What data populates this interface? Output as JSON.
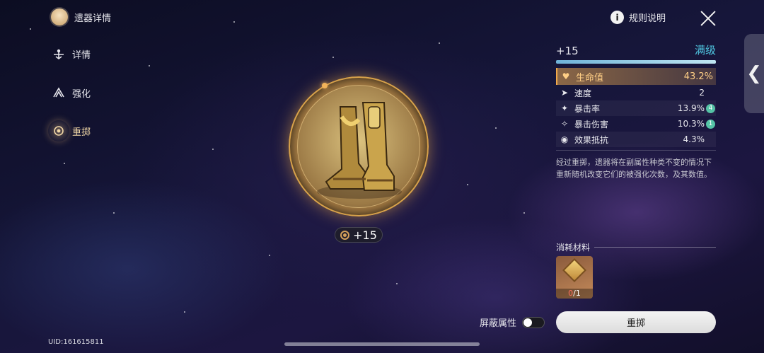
{
  "nav": {
    "header_label": "遗器详情",
    "items": [
      {
        "label": "详情",
        "icon": "detail-icon"
      },
      {
        "label": "强化",
        "icon": "enhance-icon"
      },
      {
        "label": "重掷",
        "icon": "reroll-icon",
        "active": true
      }
    ]
  },
  "topbar": {
    "rules_label": "规则说明",
    "info_icon": "i"
  },
  "relic": {
    "level_badge": "+15",
    "level_badge_icon": "relic-level-icon"
  },
  "panel": {
    "level": "+15",
    "level_status": "满级",
    "level_progress": 1.0,
    "main_stat": {
      "name": "生命值",
      "value": "43.2%",
      "icon": "heart-icon"
    },
    "sub_stats": [
      {
        "name": "速度",
        "value": "2",
        "icon": "speed-icon",
        "boost": ""
      },
      {
        "name": "暴击率",
        "value": "13.9%",
        "icon": "crit-rate-icon",
        "boost": "4"
      },
      {
        "name": "暴击伤害",
        "value": "10.3%",
        "icon": "crit-dmg-icon",
        "boost": "1"
      },
      {
        "name": "效果抵抗",
        "value": "4.3%",
        "icon": "effect-res-icon",
        "boost": ""
      }
    ],
    "description": "经过重掷，遗器将在副属性种类不变的情况下重新随机改变它们的被强化次数，及其数值。"
  },
  "materials": {
    "title": "消耗材料",
    "item_count_have": "0",
    "item_count_need": "/1"
  },
  "footer": {
    "hide_attr_label": "屏蔽属性",
    "reroll_button": "重掷",
    "uid": "UID:161615811"
  },
  "colors": {
    "accent_gold": "#ffcf86",
    "level_max": "#4fc6e0",
    "boost_badge": "#55c3a6"
  }
}
